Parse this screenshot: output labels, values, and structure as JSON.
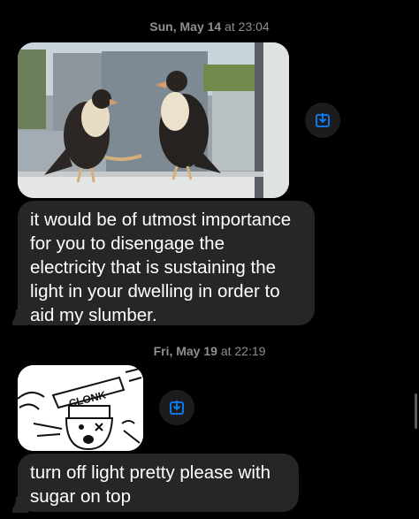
{
  "messages": [
    {
      "timestamp_day": "Sun, May 14",
      "timestamp_time": "at 23:04"
    },
    {
      "text_lines": [
        "it would be of utmost importance",
        "for you to disengage the",
        "electricity that is sustaining the",
        "light in your dwelling in order to",
        "aid my slumber."
      ]
    },
    {
      "timestamp_day": "Fri, May 19",
      "timestamp_time": "at 22:19"
    },
    {
      "comic_text": "CLONK"
    },
    {
      "text_lines": [
        "turn off light pretty please with",
        "sugar on top"
      ]
    }
  ],
  "icons": {
    "save": "download-icon"
  },
  "colors": {
    "bubble": "#262629",
    "accent": "#0a84ff",
    "timestamp": "#8e8e93"
  }
}
